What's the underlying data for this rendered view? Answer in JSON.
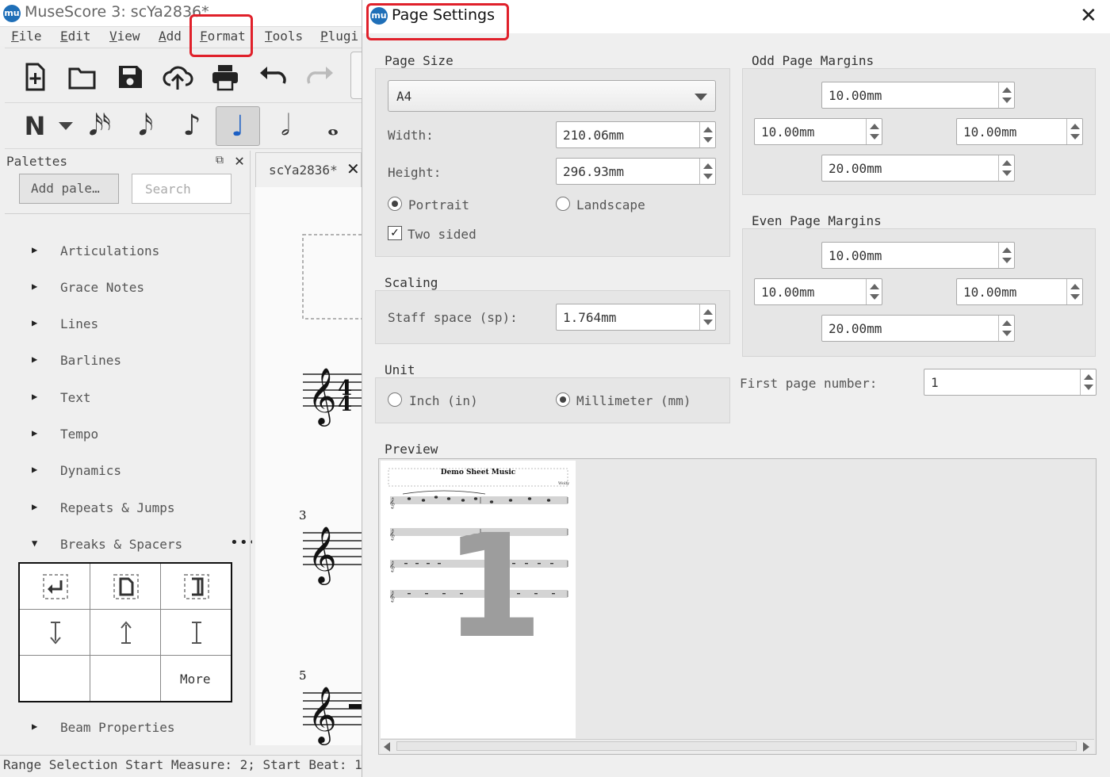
{
  "main_window": {
    "title": "MuseScore 3: scYa2836*",
    "logo": "mu",
    "menu": [
      "File",
      "Edit",
      "View",
      "Add",
      "Format",
      "Tools",
      "Plugi"
    ],
    "toolbar_icons": [
      "new-file-icon",
      "open-folder-icon",
      "save-icon",
      "cloud-upload-icon",
      "print-icon",
      "undo-icon",
      "redo-icon"
    ],
    "note_input": {
      "mode_glyph": "N",
      "durations": [
        "𝅘𝅥𝅯𝅯",
        "𝅘𝅥𝅯",
        "♪",
        "♩",
        "𝅗𝅥",
        "𝅝"
      ],
      "active_index": 3
    }
  },
  "palettes": {
    "header": "Palettes",
    "add_button": "Add pale…",
    "search_placeholder": "Search",
    "items": [
      "Articulations",
      "Grace Notes",
      "Lines",
      "Barlines",
      "Text",
      "Tempo",
      "Dynamics",
      "Repeats & Jumps",
      "Breaks & Spacers",
      "Beam Properties"
    ],
    "expanded_item": "Breaks & Spacers",
    "more_dots": "•••",
    "breaks_cells": [
      "line-break-icon",
      "page-break-icon",
      "section-break-icon",
      "staff-spacer-down-icon",
      "staff-spacer-up-icon",
      "staff-spacer-fixed-icon",
      "",
      "",
      "More"
    ]
  },
  "score": {
    "tab_label": "scYa2836*",
    "measure_numbers": [
      "3",
      "5"
    ]
  },
  "status_bar": {
    "text": "Range Selection Start Measure: 2; Start Beat: 1"
  },
  "dialog": {
    "title": "Page Settings",
    "page_size": {
      "group_title": "Page Size",
      "selected": "A4",
      "width_label": "Width:",
      "width_value": "210.06mm",
      "height_label": "Height:",
      "height_value": "296.93mm",
      "portrait_label": "Portrait",
      "landscape_label": "Landscape",
      "orientation": "portrait",
      "two_sided_label": "Two sided",
      "two_sided_checked": true
    },
    "scaling": {
      "group_title": "Scaling",
      "staff_space_label": "Staff space (sp):",
      "staff_space_value": "1.764mm"
    },
    "unit": {
      "group_title": "Unit",
      "inch_label": "Inch (in)",
      "mm_label": "Millimeter (mm)",
      "selected": "mm"
    },
    "odd_margins": {
      "group_title": "Odd Page Margins",
      "top": "10.00mm",
      "left": "10.00mm",
      "right": "10.00mm",
      "bottom": "20.00mm"
    },
    "even_margins": {
      "group_title": "Even Page Margins",
      "top": "10.00mm",
      "left": "10.00mm",
      "right": "10.00mm",
      "bottom": "20.00mm"
    },
    "first_page_label": "First page number:",
    "first_page_value": "1",
    "preview": {
      "group_title": "Preview",
      "sheet_title": "Demo Sheet Music",
      "page_number": "1",
      "composer_mark": "Wolfy"
    }
  },
  "colors": {
    "highlight": "#e0202a",
    "logo": "#1f6fb8",
    "active_note": "#1b5fc4"
  }
}
